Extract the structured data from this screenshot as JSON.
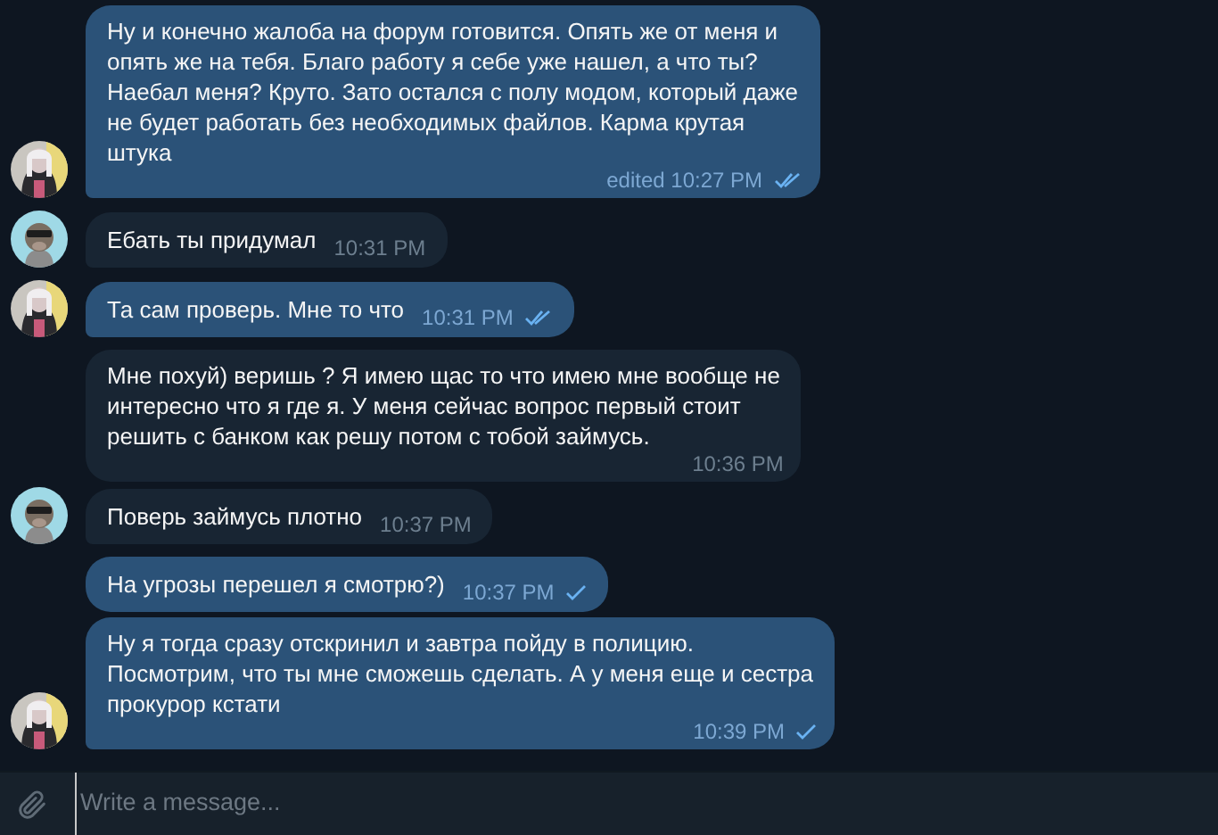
{
  "messages": [
    {
      "kind": "out",
      "text": "Ну и конечно жалоба на форум готовится. Опять же от меня и\nопять же на тебя. Благо работу я себе уже нашел, а что ты?\nНаебал меня? Круто. Зато остался с полу модом, который даже\nне будет работать без необходимых файлов. Карма крутая\nштука",
      "time": "edited 10:27 PM",
      "read": true,
      "avatar": true
    },
    {
      "kind": "in",
      "text": "Ебать ты придумал",
      "time": "10:31 PM",
      "avatar": true
    },
    {
      "kind": "out",
      "text": "Та сам проверь. Мне то что",
      "time": "10:31 PM",
      "read": true,
      "avatar": true
    },
    {
      "kind": "in",
      "text": "Мне похуй) веришь ? Я имею щас то что имею мне вообще не\nинтересно что я где я. У меня сейчас вопрос первый стоит\nрешить с банком как решу потом с тобой займусь.",
      "time": "10:36 PM",
      "avatar": false
    },
    {
      "kind": "in",
      "text": "Поверь займусь плотно",
      "time": "10:37 PM",
      "avatar": true
    },
    {
      "kind": "out",
      "text": "На угрозы перешел я смотрю?)",
      "time": "10:37 PM",
      "read": false,
      "avatar": false
    },
    {
      "kind": "out",
      "text": "Ну я тогда сразу отскринил и завтра пойду в полицию.\nПосмотрим, что ты мне сможешь сделать. А у меня еще и сестра\nпрокурор кстати",
      "time": "10:39 PM",
      "read": false,
      "avatar": true
    }
  ],
  "composer": {
    "placeholder": "Write a message..."
  }
}
